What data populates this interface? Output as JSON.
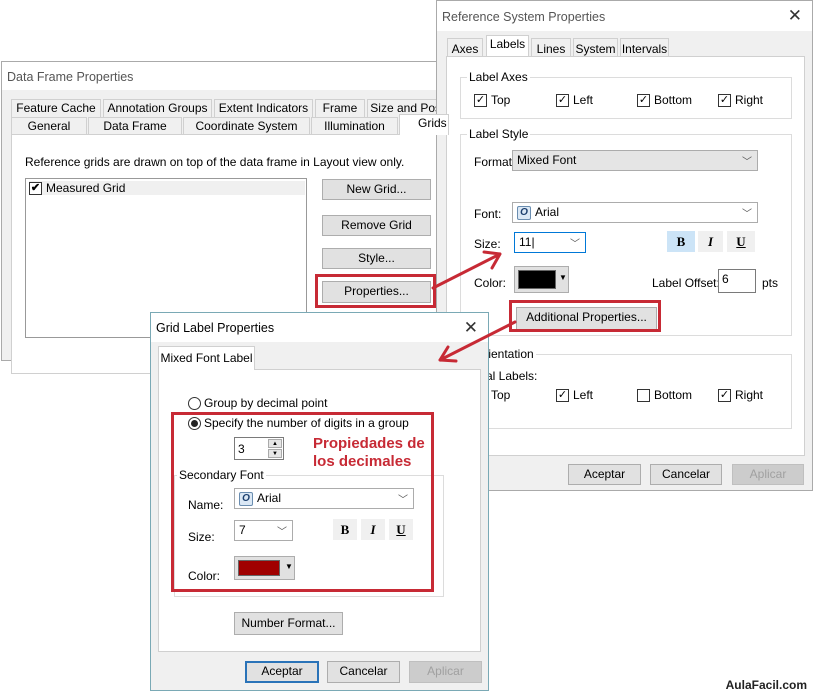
{
  "data_frame": {
    "title": "Data Frame Properties",
    "tabs_row1": [
      "Feature Cache",
      "Annotation Groups",
      "Extent Indicators",
      "Frame",
      "Size and Posi"
    ],
    "tabs_row2": [
      "General",
      "Data Frame",
      "Coordinate System",
      "Illumination",
      "Grids"
    ],
    "selected_tab": "Grids",
    "description": "Reference grids are drawn on top of the data frame in Layout view only.",
    "grids": [
      {
        "label": "Measured Grid",
        "checked": true
      }
    ],
    "buttons": {
      "new_grid": "New Grid...",
      "remove_grid": "Remove Grid",
      "style": "Style...",
      "properties": "Properties..."
    }
  },
  "reference_system": {
    "title": "Reference System Properties",
    "tabs": [
      "Axes",
      "Labels",
      "Lines",
      "System",
      "Intervals"
    ],
    "selected_tab": "Labels",
    "label_axes": {
      "title": "Label Axes",
      "items": [
        {
          "label": "Top",
          "checked": true
        },
        {
          "label": "Left",
          "checked": true
        },
        {
          "label": "Bottom",
          "checked": true
        },
        {
          "label": "Right",
          "checked": true
        }
      ]
    },
    "label_style": {
      "title": "Label Style",
      "format_label": "Format:",
      "format_value": "Mixed Font",
      "font_label": "Font:",
      "font_value": "Arial",
      "size_label": "Size:",
      "size_value": "11",
      "bold": "B",
      "italic": "I",
      "underline": "U",
      "bold_on": true,
      "color_label": "Color:",
      "color_value": "#000000",
      "offset_label": "Label Offset:",
      "offset_value": "6",
      "offset_unit": "pts",
      "additional": "Additional Properties..."
    },
    "orientation": {
      "title": "l Orientation",
      "vertical_label": "tical Labels:",
      "items": [
        {
          "label": "Top",
          "checked": true
        },
        {
          "label": "Left",
          "checked": true
        },
        {
          "label": "Bottom",
          "checked": false
        },
        {
          "label": "Right",
          "checked": true
        }
      ]
    },
    "buttons": {
      "ok": "Aceptar",
      "cancel": "Cancelar",
      "apply": "Aplicar"
    }
  },
  "grid_label": {
    "title": "Grid Label Properties",
    "tab": "Mixed Font Label",
    "radio_decimal": "Group by decimal point",
    "radio_digits": "Specify the number of digits in a group",
    "selected_radio": "digits",
    "digits_value": "3",
    "secondary_font": {
      "title": "Secondary Font",
      "name_label": "Name:",
      "name_value": "Arial",
      "size_label": "Size:",
      "size_value": "7",
      "bold": "B",
      "italic": "I",
      "underline": "U",
      "color_label": "Color:",
      "color_value": "#a00000"
    },
    "number_format": "Number Format...",
    "buttons": {
      "ok": "Aceptar",
      "cancel": "Cancelar",
      "apply": "Aplicar"
    }
  },
  "annotation": {
    "text_line1": "Propiedades de",
    "text_line2": "los decimales",
    "color": "#c72a35"
  },
  "watermark": "AulaFacil.com"
}
